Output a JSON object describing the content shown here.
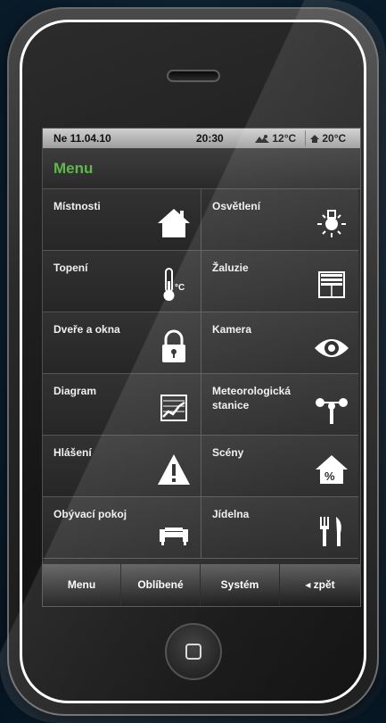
{
  "status": {
    "date": "Ne 11.04.10",
    "time": "20:30",
    "outdoor_temp": "12°C",
    "indoor_temp": "20°C"
  },
  "header": {
    "title": "Menu"
  },
  "colors": {
    "accent": "#5fb84a",
    "status_bar": "#b5b5b5",
    "tile": "#2c2c2c"
  },
  "menu_items": [
    {
      "label": "Místnosti",
      "icon": "house-icon"
    },
    {
      "label": "Osvětlení",
      "icon": "light-bulb-icon"
    },
    {
      "label": "Topení",
      "icon": "thermometer-icon"
    },
    {
      "label": "Žaluzie",
      "icon": "blinds-icon"
    },
    {
      "label": "Dveře a okna",
      "icon": "padlock-icon"
    },
    {
      "label": "Kamera",
      "icon": "eye-icon"
    },
    {
      "label": "Diagram",
      "icon": "chart-icon"
    },
    {
      "label": "Meteorologická stanice",
      "icon": "weather-station-icon"
    },
    {
      "label": "Hlášení",
      "icon": "warning-icon"
    },
    {
      "label": "Scény",
      "icon": "scene-house-percent-icon"
    },
    {
      "label": "Obývací pokoj",
      "icon": "sofa-icon"
    },
    {
      "label": "Jídelna",
      "icon": "fork-knife-icon"
    }
  ],
  "icon_text": {
    "celsius": "°C",
    "percent": "%"
  },
  "tabs": [
    {
      "label": "Menu"
    },
    {
      "label": "Oblíbené"
    },
    {
      "label": "Systém"
    },
    {
      "label": "◂ zpět"
    }
  ]
}
